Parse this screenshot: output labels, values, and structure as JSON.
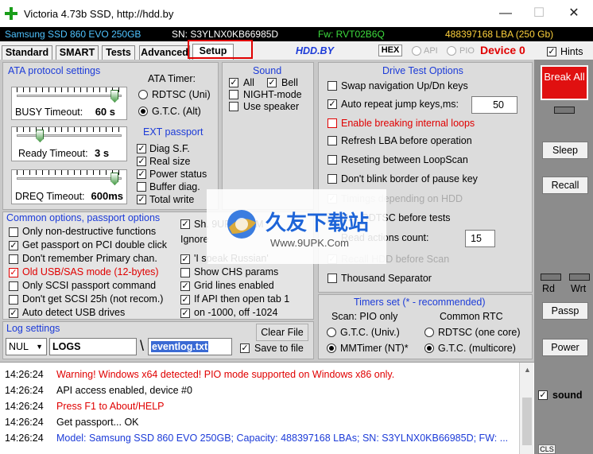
{
  "window": {
    "title": "Victoria 4.73b SSD, http://hdd.by",
    "minimize": "—",
    "maximize": "☐",
    "close": "✕"
  },
  "infobar": {
    "model": "Samsung SSD 860 EVO 250GB",
    "sn": "SN: S3YLNX0KB66985D",
    "fw": "Fw: RVT02B6Q",
    "lba": "488397168 LBA (250 Gb)"
  },
  "tabs": [
    "Standard",
    "SMART",
    "Tests",
    "Advanced",
    "Setup"
  ],
  "topbar": {
    "brand": "HDD.BY",
    "hex": "HEX",
    "api": "API",
    "pio": "PIO",
    "device": "Device 0",
    "hints": "Hints"
  },
  "ata": {
    "title": "ATA protocol settings",
    "timer_title": "ATA Timer:",
    "rdtsc": "RDTSC (Uni)",
    "gtc": "G.T.C. (Alt)",
    "busy_label": "BUSY Timeout:",
    "busy_value": "60 s",
    "busy_pos": 0.97,
    "ready_label": "Ready Timeout:",
    "ready_value": "3 s",
    "ready_pos": 0.2,
    "dreq_label": "DREQ Timeout:",
    "dreq_value": "600ms",
    "dreq_pos": 0.97
  },
  "ext": {
    "title": "EXT passport",
    "items": [
      "Diag S.F.",
      "Real size",
      "Power status",
      "Buffer diag.",
      "Total write"
    ]
  },
  "sound": {
    "title": "Sound",
    "all": "All",
    "bell": "Bell",
    "night": "NIGHT-mode",
    "speaker": "Use speaker"
  },
  "dto": {
    "title": "Drive Test Options",
    "items": [
      "Swap navigation Up/Dn keys",
      "Auto repeat jump keys,ms:",
      "Enable breaking internal loops",
      "Refresh LBA before operation",
      "Reseting between LoopScan",
      "Don't blink border of pause key",
      "Timings depending on HDD",
      "Use RDTSC before tests",
      "Read actions count:",
      "Recall HDD before Scan",
      "Thousand Separator"
    ],
    "auto_repeat_value": "50",
    "read_count_value": "15"
  },
  "timers": {
    "title": "Timers set  (* - recommended)",
    "scan_title": "Scan: PIO only",
    "rtc_title": "Common RTC",
    "gtc_univ": "G.T.C. (Univ.)",
    "mmtimer": "MMTimer (NT)*",
    "rdtsc_one": "RDTSC (one core)",
    "gtc_multi": "G.T.C.  (multicore)"
  },
  "common": {
    "title": "Common options, passport options",
    "items": [
      "Only non-destructive functions",
      "Get passport on PCI double click",
      "Don't remember Primary chan.",
      "Old USB/SAS mode (12-bytes)",
      "Only SCSI passport command",
      "Don't get SCSI 25h (not recom.)",
      "Auto detect USB drives"
    ],
    "right_items": [
      "Sh. 9UPK.COM",
      "Ignore",
      "'I speak Russian'",
      "Show CHS params",
      "Grid lines enabled",
      "If API then open tab 1",
      "on -1000, off -1024"
    ]
  },
  "logsettings": {
    "title": "Log settings",
    "nul": "NUL",
    "folder": "LOGS",
    "slash": "\\",
    "file": "eventlog.txt",
    "clear": "Clear File",
    "save": "Save to file"
  },
  "log": [
    {
      "ts": "14:26:24",
      "msg": "Warning! Windows x64 detected! PIO mode supported on Windows x86 only.",
      "color": "#e00000"
    },
    {
      "ts": "14:26:24",
      "msg": "API access enabled, device #0",
      "color": "#000000"
    },
    {
      "ts": "14:26:24",
      "msg": "Press F1 to About/HELP",
      "color": "#e00000"
    },
    {
      "ts": "14:26:24",
      "msg": "Get passport... OK",
      "color": "#000000"
    },
    {
      "ts": "14:26:24",
      "msg": "Model: Samsung SSD 860 EVO 250GB; Capacity: 488397168 LBAs; SN: S3YLNX0KB66985D; FW: ...",
      "color": "#1c3bd8"
    }
  ],
  "side": {
    "break": "Break All",
    "sleep": "Sleep",
    "recall": "Recall",
    "rd": "Rd",
    "wrt": "Wrt",
    "passp": "Passp",
    "power": "Power",
    "sound": "sound",
    "cls": "CLS"
  },
  "watermark": {
    "cn": "久友下载站",
    "url": "Www.9UPK.Com"
  }
}
